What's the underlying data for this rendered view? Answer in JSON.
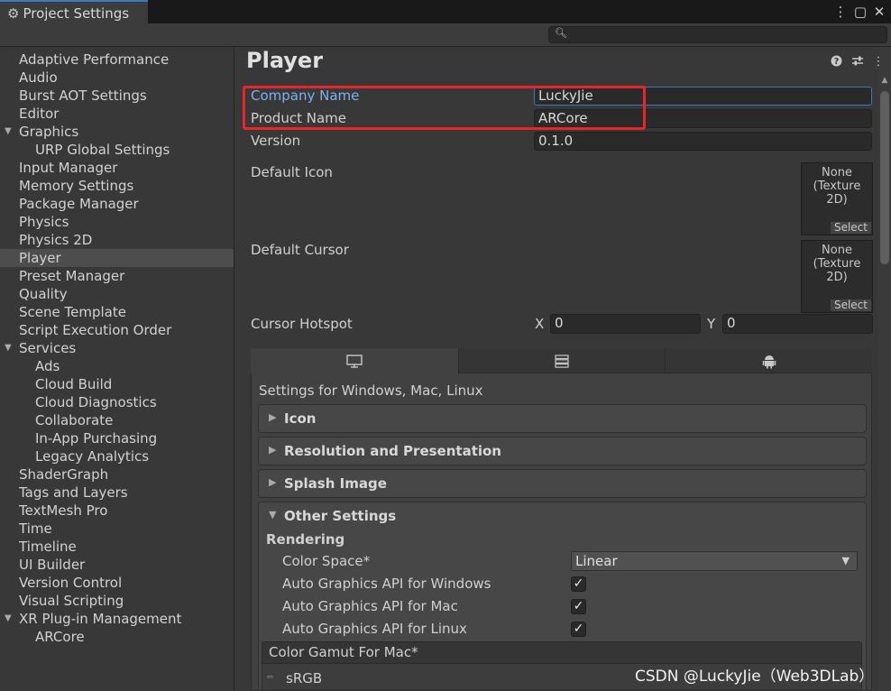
{
  "window": {
    "title": "Project Settings",
    "menu_icon": "kebab-menu-icon",
    "maximize_icon": "maximize-icon",
    "close_icon": "close-icon",
    "search_placeholder": ""
  },
  "sidebar": {
    "items": [
      {
        "label": "Adaptive Performance",
        "indent": 0
      },
      {
        "label": "Audio",
        "indent": 0
      },
      {
        "label": "Burst AOT Settings",
        "indent": 0
      },
      {
        "label": "Editor",
        "indent": 0
      },
      {
        "label": "Graphics",
        "indent": 0,
        "expanded": true
      },
      {
        "label": "URP Global Settings",
        "indent": 1
      },
      {
        "label": "Input Manager",
        "indent": 0
      },
      {
        "label": "Memory Settings",
        "indent": 0
      },
      {
        "label": "Package Manager",
        "indent": 0
      },
      {
        "label": "Physics",
        "indent": 0
      },
      {
        "label": "Physics 2D",
        "indent": 0
      },
      {
        "label": "Player",
        "indent": 0,
        "selected": true
      },
      {
        "label": "Preset Manager",
        "indent": 0
      },
      {
        "label": "Quality",
        "indent": 0
      },
      {
        "label": "Scene Template",
        "indent": 0
      },
      {
        "label": "Script Execution Order",
        "indent": 0
      },
      {
        "label": "Services",
        "indent": 0,
        "expanded": true
      },
      {
        "label": "Ads",
        "indent": 1
      },
      {
        "label": "Cloud Build",
        "indent": 1
      },
      {
        "label": "Cloud Diagnostics",
        "indent": 1
      },
      {
        "label": "Collaborate",
        "indent": 1
      },
      {
        "label": "In-App Purchasing",
        "indent": 1
      },
      {
        "label": "Legacy Analytics",
        "indent": 1
      },
      {
        "label": "ShaderGraph",
        "indent": 0
      },
      {
        "label": "Tags and Layers",
        "indent": 0
      },
      {
        "label": "TextMesh Pro",
        "indent": 0
      },
      {
        "label": "Time",
        "indent": 0
      },
      {
        "label": "Timeline",
        "indent": 0
      },
      {
        "label": "UI Builder",
        "indent": 0
      },
      {
        "label": "Version Control",
        "indent": 0
      },
      {
        "label": "Visual Scripting",
        "indent": 0
      },
      {
        "label": "XR Plug-in Management",
        "indent": 0,
        "expanded": true
      },
      {
        "label": "ARCore",
        "indent": 1
      }
    ]
  },
  "player": {
    "title": "Player",
    "header_icons": [
      "help-icon",
      "presets-icon",
      "kebab-menu-icon"
    ],
    "company_name_label": "Company Name",
    "company_name_value": "LuckyJie",
    "product_name_label": "Product Name",
    "product_name_value": "ARCore",
    "version_label": "Version",
    "version_value": "0.1.0",
    "default_icon_label": "Default Icon",
    "default_cursor_label": "Default Cursor",
    "object_field_none": "None",
    "object_field_type": "(Texture 2D)",
    "object_field_select": "Select",
    "cursor_hotspot_label": "Cursor Hotspot",
    "hotspot_x_label": "X",
    "hotspot_x_value": "0",
    "hotspot_y_label": "Y",
    "hotspot_y_value": "0"
  },
  "platform": {
    "tab_icons": [
      "monitor-icon",
      "server-icon",
      "android-icon"
    ],
    "settings_for": "Settings for Windows, Mac, Linux",
    "sections": {
      "icon": "Icon",
      "resolution": "Resolution and Presentation",
      "splash": "Splash Image",
      "other": "Other Settings"
    },
    "rendering_label": "Rendering",
    "color_space_label": "Color Space*",
    "color_space_value": "Linear",
    "auto_api_windows_label": "Auto Graphics API  for Windows",
    "auto_api_mac_label": "Auto Graphics API  for Mac",
    "auto_api_linux_label": "Auto Graphics API  for Linux",
    "auto_api_windows": true,
    "auto_api_mac": true,
    "auto_api_linux": true,
    "color_gamut_label": "Color Gamut For Mac*",
    "color_gamut_item": "sRGB"
  },
  "watermark": "CSDN @LuckyJie（Web3DLab）",
  "colors": {
    "accent": "#3a79bb",
    "highlight_box": "#e8262a",
    "focused_label": "#7fb1f0"
  }
}
